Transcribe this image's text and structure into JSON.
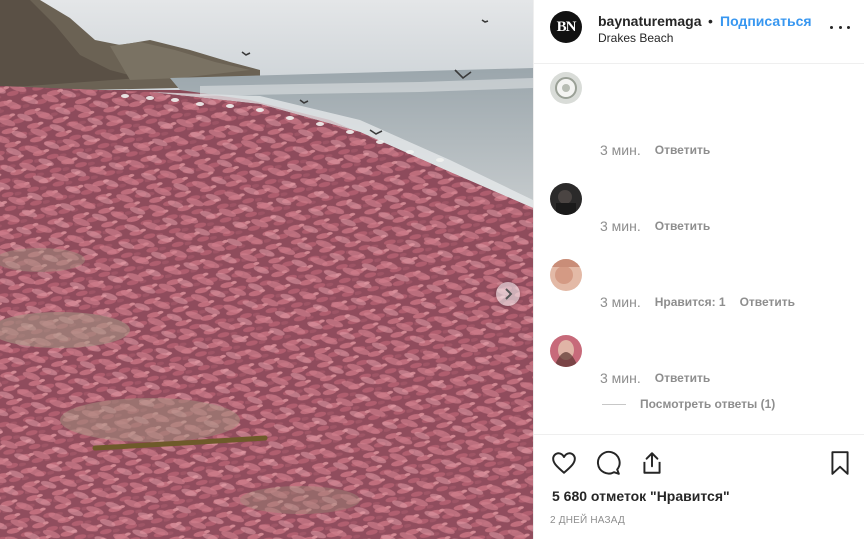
{
  "post": {
    "username": "baynaturemaga",
    "separator": "•",
    "follow_label": "Подписаться",
    "location": "Drakes Beach",
    "avatar_initials": "BN"
  },
  "comments": [
    {
      "time": "3 мин.",
      "likes_label": "",
      "reply_label": "Ответить"
    },
    {
      "time": "3 мин.",
      "likes_label": "",
      "reply_label": "Ответить"
    },
    {
      "time": "3 мин.",
      "likes_label": "Нравится: 1",
      "reply_label": "Ответить"
    },
    {
      "time": "3 мин.",
      "likes_label": "",
      "reply_label": "Ответить"
    }
  ],
  "view_replies_label": "Посмотреть ответы (1)",
  "likes_count_label": "5 680 отметок \"Нравится\"",
  "date_label": "2 ДНЕЙ НАЗАД",
  "icons": {
    "like": "heart-icon",
    "comment": "comment-bubble-icon",
    "share": "share-icon",
    "save": "bookmark-icon",
    "more": "ellipsis-icon",
    "next": "chevron-right-icon"
  },
  "colors": {
    "link": "#3897f0",
    "text": "#262626",
    "muted": "#8e8e8e"
  }
}
